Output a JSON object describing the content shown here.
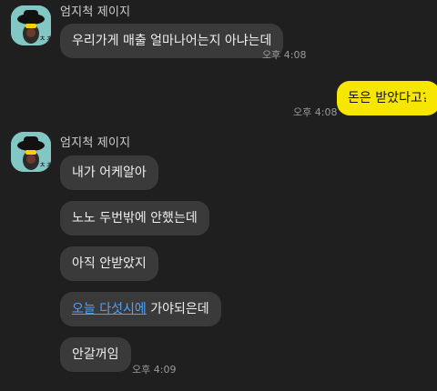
{
  "messages": [
    {
      "sender": "엄지척 제이지",
      "text": "우리가게 매출 얼마나어는지 아냐는데",
      "time": "오후 4:08"
    },
    {
      "sender_self": true,
      "text": "돈은 받았다고?",
      "time": "오후 4:08"
    },
    {
      "sender": "엄지척 제이지",
      "text": "내가 어케알아"
    },
    {
      "text": "노노 두번밖에 안했는데"
    },
    {
      "text": "아직 안받았지"
    },
    {
      "text_link": "오늘 다섯시에",
      "text_rest": "가야되은데"
    },
    {
      "text": "안갈꺼임",
      "time": "오후 4:09"
    }
  ],
  "colors": {
    "background": "#1f1f1f",
    "bubble_other": "#3a3a3a",
    "bubble_self": "#f7e600",
    "link": "#4aa3ff"
  },
  "icons": {
    "avatar": "profile-avatar-icon"
  }
}
